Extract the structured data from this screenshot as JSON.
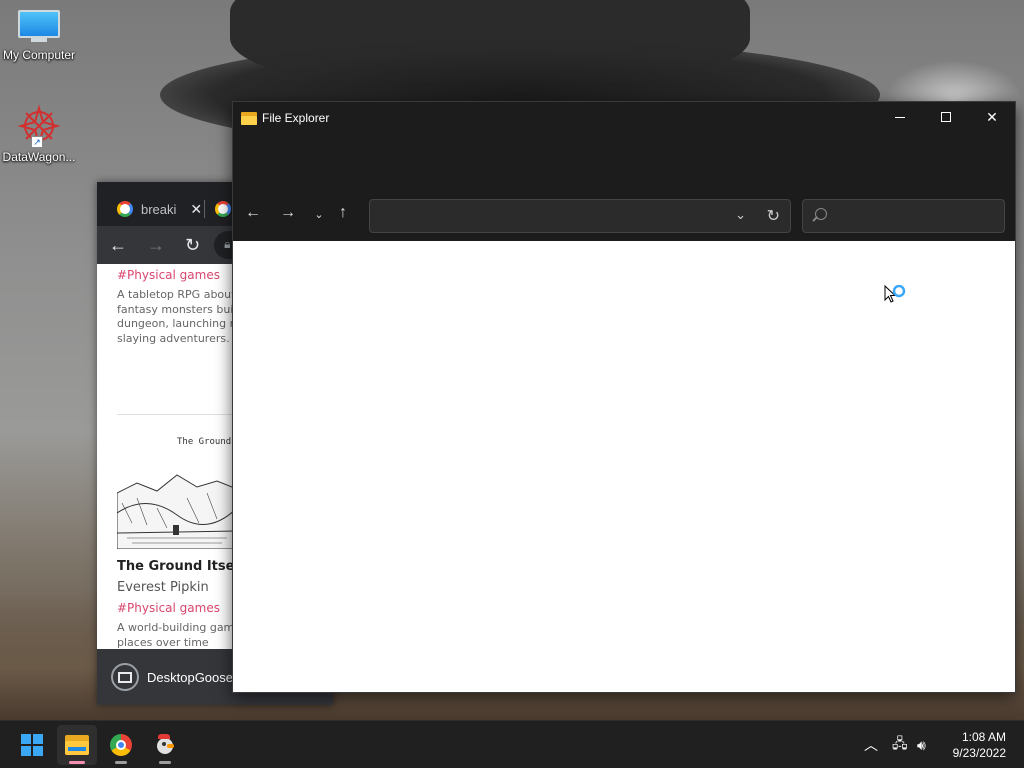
{
  "desktop": {
    "icons": [
      {
        "label": "My Computer",
        "icon": "monitor-icon"
      },
      {
        "label": "DataWagon...",
        "icon": "datawagon-icon"
      }
    ]
  },
  "chrome": {
    "tab1_title": "breaki",
    "tab_close": "✕",
    "content": {
      "item1_tag": "#Physical games",
      "item1_desc": "A tabletop RPG about\nfantasy monsters build\ndungeon, launching ra\nslaying adventurers.",
      "item2_caption": "The Ground",
      "item2_title": "The Ground Itself",
      "item2_author": "Everest Pipkin",
      "item2_tag": "#Physical games",
      "item2_desc": "A world-building game\nplaces over time"
    },
    "download_label": "DesktopGoose"
  },
  "file_explorer": {
    "title": "File Explorer",
    "address_value": "",
    "search_placeholder": ""
  },
  "taskbar": {
    "apps": [
      "start-icon",
      "file-explorer-icon",
      "chrome-icon",
      "desktop-goose-icon"
    ],
    "time": "1:08 AM",
    "date": "9/23/2022"
  },
  "colors": {
    "accent": "#3aa8f5",
    "tag": "#d9466f",
    "folder": "#ffc83d"
  }
}
